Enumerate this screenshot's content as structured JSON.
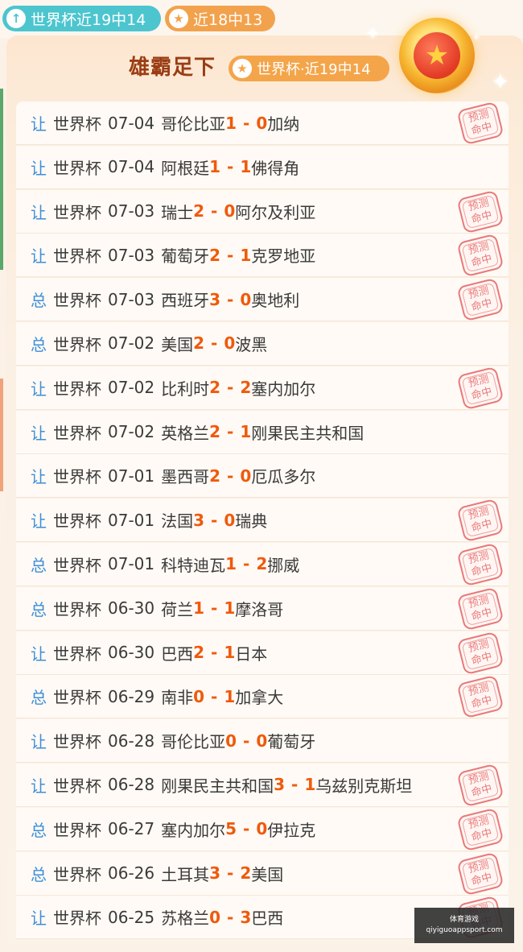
{
  "top_pills": [
    {
      "icon": "arrow-up-icon",
      "label": "世界杯近19中14"
    },
    {
      "icon": "star-icon",
      "label": "近18中13"
    }
  ],
  "header": {
    "title": "雄霸足下",
    "badge": "世界杯·近19中14",
    "medal_icon": "star-medal-icon"
  },
  "stamp_text": [
    "预测",
    "命中"
  ],
  "rows": [
    {
      "type": "让",
      "league": "世界杯",
      "date": "07-04",
      "home": "哥伦比亚",
      "hs": "1",
      "as": "0",
      "away": "加纳",
      "hit": true
    },
    {
      "type": "让",
      "league": "世界杯",
      "date": "07-04",
      "home": "阿根廷",
      "hs": "1",
      "as": "1",
      "away": "佛得角",
      "hit": false
    },
    {
      "type": "让",
      "league": "世界杯",
      "date": "07-03",
      "home": "瑞士",
      "hs": "2",
      "as": "0",
      "away": "阿尔及利亚",
      "hit": true
    },
    {
      "type": "让",
      "league": "世界杯",
      "date": "07-03",
      "home": "葡萄牙",
      "hs": "2",
      "as": "1",
      "away": "克罗地亚",
      "hit": true
    },
    {
      "type": "总",
      "league": "世界杯",
      "date": "07-03",
      "home": "西班牙",
      "hs": "3",
      "as": "0",
      "away": "奥地利",
      "hit": true
    },
    {
      "type": "总",
      "league": "世界杯",
      "date": "07-02",
      "home": "美国",
      "hs": "2",
      "as": "0",
      "away": "波黑",
      "hit": false
    },
    {
      "type": "让",
      "league": "世界杯",
      "date": "07-02",
      "home": "比利时",
      "hs": "2",
      "as": "2",
      "away": "塞内加尔",
      "hit": true
    },
    {
      "type": "让",
      "league": "世界杯",
      "date": "07-02",
      "home": "英格兰",
      "hs": "2",
      "as": "1",
      "away": "刚果民主共和国",
      "hit": false
    },
    {
      "type": "让",
      "league": "世界杯",
      "date": "07-01",
      "home": "墨西哥",
      "hs": "2",
      "as": "0",
      "away": "厄瓜多尔",
      "hit": false
    },
    {
      "type": "让",
      "league": "世界杯",
      "date": "07-01",
      "home": "法国",
      "hs": "3",
      "as": "0",
      "away": "瑞典",
      "hit": true
    },
    {
      "type": "总",
      "league": "世界杯",
      "date": "07-01",
      "home": "科特迪瓦",
      "hs": "1",
      "as": "2",
      "away": "挪威",
      "hit": true
    },
    {
      "type": "总",
      "league": "世界杯",
      "date": "06-30",
      "home": "荷兰",
      "hs": "1",
      "as": "1",
      "away": "摩洛哥",
      "hit": true
    },
    {
      "type": "让",
      "league": "世界杯",
      "date": "06-30",
      "home": "巴西",
      "hs": "2",
      "as": "1",
      "away": "日本",
      "hit": true
    },
    {
      "type": "总",
      "league": "世界杯",
      "date": "06-29",
      "home": "南非",
      "hs": "0",
      "as": "1",
      "away": "加拿大",
      "hit": true
    },
    {
      "type": "让",
      "league": "世界杯",
      "date": "06-28",
      "home": "哥伦比亚",
      "hs": "0",
      "as": "0",
      "away": "葡萄牙",
      "hit": false
    },
    {
      "type": "让",
      "league": "世界杯",
      "date": "06-28",
      "home": "刚果民主共和国",
      "hs": "3",
      "as": "1",
      "away": "乌兹别克斯坦",
      "hit": true
    },
    {
      "type": "总",
      "league": "世界杯",
      "date": "06-27",
      "home": "塞内加尔",
      "hs": "5",
      "as": "0",
      "away": "伊拉克",
      "hit": true
    },
    {
      "type": "总",
      "league": "世界杯",
      "date": "06-26",
      "home": "土耳其",
      "hs": "3",
      "as": "2",
      "away": "美国",
      "hit": true
    },
    {
      "type": "让",
      "league": "世界杯",
      "date": "06-25",
      "home": "苏格兰",
      "hs": "0",
      "as": "3",
      "away": "巴西",
      "hit": true
    }
  ],
  "watermark": {
    "line1": "体育游戏",
    "line2": "qiyiguoappsport.com"
  },
  "colors": {
    "accent": "#ef5a0c",
    "type_blue": "#3d8fd8",
    "title_brown": "#9a3d14",
    "stamp_red": "#e87a7a"
  }
}
